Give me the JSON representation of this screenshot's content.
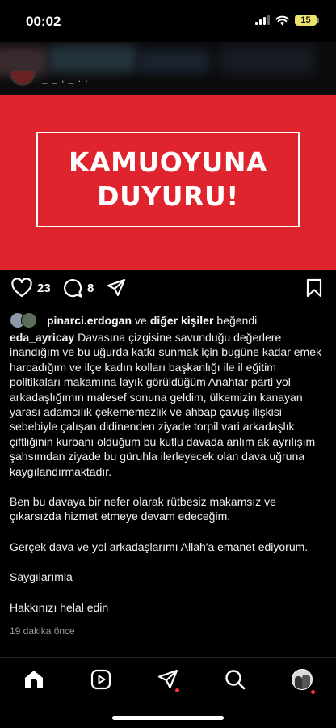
{
  "status_bar": {
    "time": "00:02",
    "battery": "15"
  },
  "post": {
    "username_partial": "_ _ ,   _   .   .",
    "image_text": [
      "KAMUOYUNA",
      "DUYURU!"
    ],
    "like_count": "23",
    "comment_count": "8",
    "liked_by_user": "pinarci.erdogan",
    "liked_by_joiner": "ve",
    "liked_by_others": "diğer kişiler",
    "liked_by_suffix": "beğendi",
    "caption_author": "eda_ayricay",
    "caption_first": "Davasına çizgisine savunduğu değerlere inandığım ve bu uğurda katkı sunmak için bugüne kadar emek harcadığım ve ilçe kadın kolları başkanlığı ile il eğitim politikaları makamına layık görüldüğüm Anahtar parti yol arkadaşlığımın malesef sonuna geldim, ülkemizin kanayan yarası adamcılık çekememezlik ve ahbap çavuş ilişkisi sebebiyle çalışan didinenden ziyade torpil vari arkadaşlık çiftliğinin kurbanı olduğum bu kutlu davada anlım ak ayrılışım şahsımdan ziyade bu güruhla ilerleyecek olan  dava uğruna kaygılandırmaktadır.",
    "caption_paragraphs": [
      "Ben bu davaya bir nefer olarak rütbesiz makamsız ve çıkarsızda hizmet etmeye devam edeceğim.",
      "Gerçek dava ve yol arkadaşlarımı Allah'a emanet ediyorum.",
      "Saygılarımla",
      "Hakkınızı helal edin"
    ],
    "timestamp": "19 dakika önce"
  },
  "icons": {
    "like": "heart-icon",
    "comment": "comment-icon",
    "share": "send-icon",
    "save": "bookmark-icon",
    "nav": [
      "home-icon",
      "reels-icon",
      "direct-icon",
      "search-icon",
      "profile-avatar"
    ]
  },
  "colors": {
    "hero_red": "#e0242d",
    "notification_dot": "#ff3040",
    "battery": "#e9e36a"
  }
}
